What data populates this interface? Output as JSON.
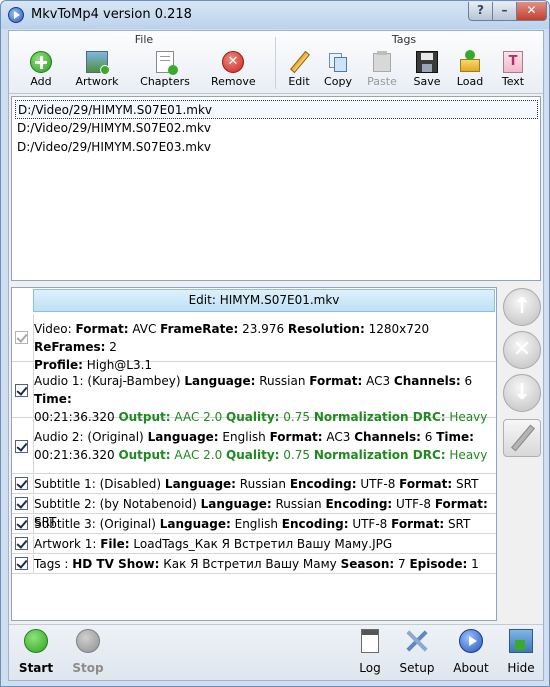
{
  "window": {
    "title": "MkvToMp4 version 0.218"
  },
  "toolbar": {
    "file_group": "File",
    "tags_group": "Tags",
    "add": "Add",
    "artwork": "Artwork",
    "chapters": "Chapters",
    "remove": "Remove",
    "edit": "Edit",
    "copy": "Copy",
    "paste": "Paste",
    "save": "Save",
    "load": "Load",
    "text": "Text"
  },
  "files": [
    "D:/Video/29/HIMYM.S07E01.mkv",
    "D:/Video/29/HIMYM.S07E02.mkv",
    "D:/Video/29/HIMYM.S07E03.mkv"
  ],
  "detail": {
    "header": "Edit: HIMYM.S07E01.mkv",
    "video": {
      "prefix": "Video: ",
      "format_label": "Format:",
      "format": " AVC ",
      "framerate_label": "FrameRate:",
      "framerate": " 23.976 ",
      "resolution_label": "Resolution:",
      "resolution": " 1280x720 ",
      "reframes_label": "ReFrames:",
      "reframes": " 2",
      "profile_label": "Profile:",
      "profile": " High@L3.1"
    },
    "audio1": {
      "prefix": "Audio 1: (Kuraj-Bambey) ",
      "language_label": "Language:",
      "language": " Russian ",
      "format_label": "Format:",
      "format": " AC3 ",
      "channels_label": "Channels:",
      "channels": " 6 ",
      "time_label": "Time:",
      "time": "00:21:36.320 ",
      "output_label": "Output:",
      "output": " AAC 2.0 ",
      "quality_label": "Quality:",
      "quality": " 0.75 ",
      "drc_label": "Normalization DRC:",
      "drc": " Heavy"
    },
    "audio2": {
      "prefix": "Audio 2: (Original) ",
      "language_label": "Language:",
      "language": " English ",
      "format_label": "Format:",
      "format": " AC3 ",
      "channels_label": "Channels:",
      "channels": " 6 ",
      "time_label": "Time:",
      "time": "00:21:36.320 ",
      "output_label": "Output:",
      "output": " AAC 2.0 ",
      "quality_label": "Quality:",
      "quality": " 0.75 ",
      "drc_label": "Normalization DRC:",
      "drc": " Heavy"
    },
    "subtitle1": {
      "prefix": "Subtitle 1: (Disabled) ",
      "language_label": "Language:",
      "language": " Russian ",
      "encoding_label": "Encoding:",
      "encoding": " UTF-8 ",
      "format_label": "Format:",
      "format": " SRT"
    },
    "subtitle2": {
      "prefix": "Subtitle 2: (by Notabenoid) ",
      "language_label": "Language:",
      "language": " Russian ",
      "encoding_label": "Encoding:",
      "encoding": " UTF-8 ",
      "format_label": "Format:",
      "format": " SRT"
    },
    "subtitle3": {
      "prefix": "Subtitle 3: (Original) ",
      "language_label": "Language:",
      "language": " English ",
      "encoding_label": "Encoding:",
      "encoding": " UTF-8 ",
      "format_label": "Format:",
      "format": " SRT"
    },
    "artwork": {
      "prefix": "Artwork 1: ",
      "file_label": "File:",
      "file": " LoadTags_Как Я Встретил Вашу Маму.JPG"
    },
    "tags": {
      "prefix": "Tags : ",
      "show_label": "HD TV Show:",
      "show": " Как Я Встретил Вашу Маму ",
      "season_label": "Season:",
      "season": " 7 ",
      "episode_label": "Episode:",
      "episode": " 1"
    }
  },
  "bottom": {
    "start": "Start",
    "stop": "Stop",
    "log": "Log",
    "setup": "Setup",
    "about": "About",
    "hide": "Hide"
  },
  "colors": {
    "output_green": "#1f8a1f",
    "start_green": "#3cb02c",
    "remove_red": "#d9342b",
    "header_blue": "#bfe0f5"
  }
}
